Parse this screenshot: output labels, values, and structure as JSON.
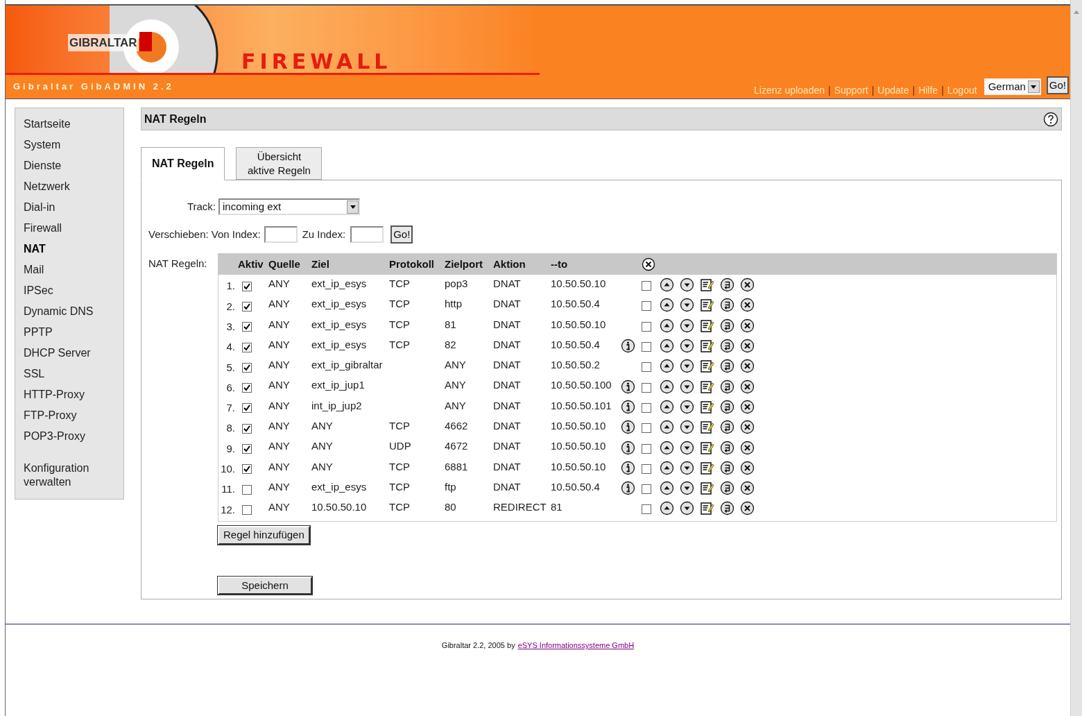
{
  "header": {
    "logo": "GIBRALTAR",
    "banner": "FIREWALL",
    "app_title": "Gibraltar GibADMIN 2.2",
    "links": [
      "Lizenz uploaden",
      "Support",
      "Update",
      "Hilfe",
      "Logout"
    ],
    "separator": "|",
    "language": "German",
    "go": "Go!"
  },
  "sidebar": {
    "items": [
      {
        "label": "Startseite",
        "selected": false
      },
      {
        "label": "System",
        "selected": false
      },
      {
        "label": "Dienste",
        "selected": false
      },
      {
        "label": "Netzwerk",
        "selected": false
      },
      {
        "label": "Dial-in",
        "selected": false
      },
      {
        "label": "Firewall",
        "selected": false
      },
      {
        "label": "NAT",
        "selected": true
      },
      {
        "label": "Mail",
        "selected": false
      },
      {
        "label": "IPSec",
        "selected": false
      },
      {
        "label": "Dynamic DNS",
        "selected": false
      },
      {
        "label": "PPTP",
        "selected": false
      },
      {
        "label": "DHCP Server",
        "selected": false
      },
      {
        "label": "SSL",
        "selected": false
      },
      {
        "label": "HTTP-Proxy",
        "selected": false
      },
      {
        "label": "FTP-Proxy",
        "selected": false
      },
      {
        "label": "POP3-Proxy",
        "selected": false
      }
    ],
    "extra_item": {
      "label": "Konfiguration verwalten",
      "selected": false
    }
  },
  "panel": {
    "title": "NAT Regeln",
    "tabs": [
      {
        "label": "NAT Regeln",
        "selected": true
      },
      {
        "label": "Übersicht aktive Regeln",
        "selected": false
      }
    ],
    "track": {
      "label": "Track:",
      "value": "incoming ext"
    },
    "move": {
      "label": "Verschieben:",
      "from_label": "Von Index:",
      "to_label": "Zu Index:",
      "go": "Go!"
    },
    "table_label": "NAT Regeln:",
    "columns": [
      "Aktiv",
      "Quelle",
      "Ziel",
      "Protokoll",
      "Zielport",
      "Aktion",
      "--to"
    ],
    "rows": [
      {
        "index": "1.",
        "active": true,
        "quelle": "ANY",
        "ziel": "ext_ip_esys",
        "protokoll": "TCP",
        "zielport": "pop3",
        "aktion": "DNAT",
        "to": "10.50.50.10",
        "info": false,
        "marked": false
      },
      {
        "index": "2.",
        "active": true,
        "quelle": "ANY",
        "ziel": "ext_ip_esys",
        "protokoll": "TCP",
        "zielport": "http",
        "aktion": "DNAT",
        "to": "10.50.50.4",
        "info": false,
        "marked": false
      },
      {
        "index": "3.",
        "active": true,
        "quelle": "ANY",
        "ziel": "ext_ip_esys",
        "protokoll": "TCP",
        "zielport": "81",
        "aktion": "DNAT",
        "to": "10.50.50.10",
        "info": false,
        "marked": false
      },
      {
        "index": "4.",
        "active": true,
        "quelle": "ANY",
        "ziel": "ext_ip_esys",
        "protokoll": "TCP",
        "zielport": "82",
        "aktion": "DNAT",
        "to": "10.50.50.4",
        "info": true,
        "marked": false
      },
      {
        "index": "5.",
        "active": true,
        "quelle": "ANY",
        "ziel": "ext_ip_gibraltar",
        "protokoll": "",
        "zielport": "ANY",
        "aktion": "DNAT",
        "to": "10.50.50.2",
        "info": false,
        "marked": false
      },
      {
        "index": "6.",
        "active": true,
        "quelle": "ANY",
        "ziel": "ext_ip_jup1",
        "protokoll": "",
        "zielport": "ANY",
        "aktion": "DNAT",
        "to": "10.50.50.100",
        "info": true,
        "marked": false
      },
      {
        "index": "7.",
        "active": true,
        "quelle": "ANY",
        "ziel": "int_ip_jup2",
        "protokoll": "",
        "zielport": "ANY",
        "aktion": "DNAT",
        "to": "10.50.50.101",
        "info": true,
        "marked": false
      },
      {
        "index": "8.",
        "active": true,
        "quelle": "ANY",
        "ziel": "ANY",
        "protokoll": "TCP",
        "zielport": "4662",
        "aktion": "DNAT",
        "to": "10.50.50.10",
        "info": true,
        "marked": false
      },
      {
        "index": "9.",
        "active": true,
        "quelle": "ANY",
        "ziel": "ANY",
        "protokoll": "UDP",
        "zielport": "4672",
        "aktion": "DNAT",
        "to": "10.50.50.10",
        "info": true,
        "marked": false
      },
      {
        "index": "10.",
        "active": true,
        "quelle": "ANY",
        "ziel": "ANY",
        "protokoll": "TCP",
        "zielport": "6881",
        "aktion": "DNAT",
        "to": "10.50.50.10",
        "info": true,
        "marked": false
      },
      {
        "index": "11.",
        "active": false,
        "quelle": "ANY",
        "ziel": "ext_ip_esys",
        "protokoll": "TCP",
        "zielport": "ftp",
        "aktion": "DNAT",
        "to": "10.50.50.4",
        "info": true,
        "marked": false
      },
      {
        "index": "12.",
        "active": false,
        "quelle": "ANY",
        "ziel": "10.50.50.10",
        "protokoll": "TCP",
        "zielport": "80",
        "aktion": "REDIRECT",
        "to": "81",
        "info": false,
        "marked": false
      }
    ],
    "add_button": "Regel hinzufügen",
    "save_button": "Speichern"
  },
  "footer": {
    "text": "Gibraltar 2.2, 2005 by",
    "link": "eSYS Informationssysteme GmbH"
  }
}
